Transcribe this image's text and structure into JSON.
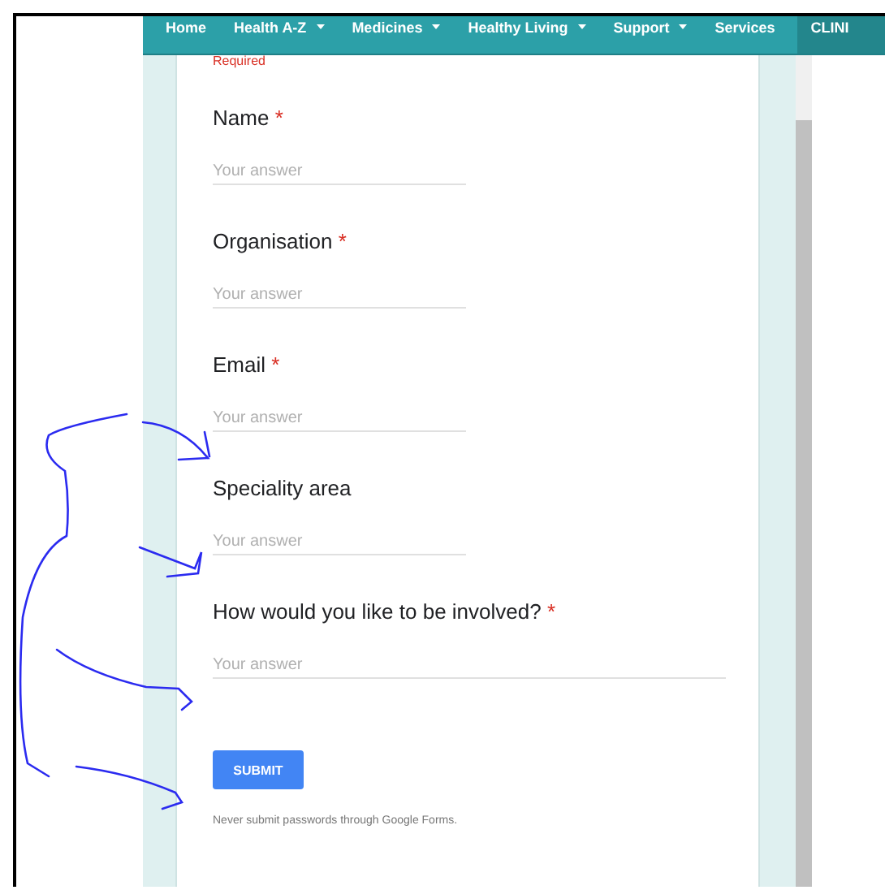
{
  "nav": {
    "items": [
      {
        "label": "Home",
        "dropdown": false,
        "kind": "link"
      },
      {
        "label": "Health A-Z",
        "dropdown": true,
        "kind": "link"
      },
      {
        "label": "Medicines",
        "dropdown": true,
        "kind": "link"
      },
      {
        "label": "Healthy Living",
        "dropdown": true,
        "kind": "link"
      },
      {
        "label": "Support",
        "dropdown": true,
        "kind": "link"
      },
      {
        "label": "Services",
        "dropdown": false,
        "kind": "link"
      },
      {
        "label": "CLINI",
        "dropdown": false,
        "kind": "highlight"
      }
    ]
  },
  "form": {
    "required_note": "Required",
    "questions": [
      {
        "label": "Name",
        "required_mark": "*",
        "placeholder": "Your answer",
        "kind": "short"
      },
      {
        "label": "Organisation",
        "required_mark": "*",
        "placeholder": "Your answer",
        "kind": "short"
      },
      {
        "label": "Email",
        "required_mark": "*",
        "placeholder": "Your answer",
        "kind": "short"
      },
      {
        "label": "Speciality area",
        "placeholder": "Your answer",
        "kind": "short"
      },
      {
        "label": "How would you like to be involved?",
        "required_mark": "*",
        "placeholder": "Your answer",
        "kind": "long"
      }
    ],
    "submit": "SUBMIT",
    "footer": "Never submit passwords through Google Forms."
  }
}
